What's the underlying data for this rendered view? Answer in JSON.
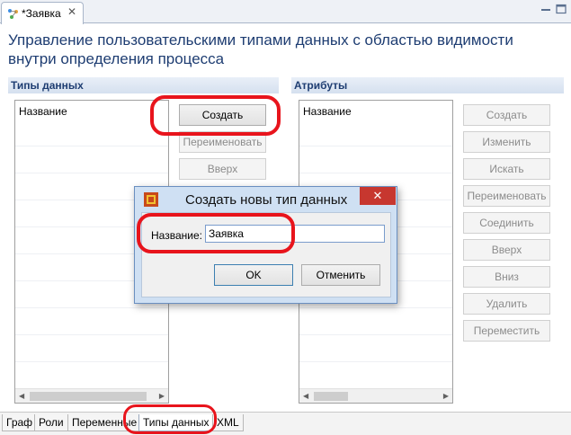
{
  "editor_tab": {
    "title": "*Заявка",
    "close_symbol": "✕"
  },
  "page_title": "Управление пользовательскими типами данных с областью видимости внутри определения процесса",
  "types_section": {
    "header": "Типы данных",
    "column_header": "Название",
    "buttons": {
      "create": "Создать",
      "rename": "Переименовать",
      "up": "Вверх"
    }
  },
  "attributes_section": {
    "header": "Атрибуты",
    "column_header": "Название",
    "buttons": {
      "create": "Создать",
      "edit": "Изменить",
      "search": "Искать",
      "rename": "Переименовать",
      "join": "Соединить",
      "up": "Вверх",
      "down": "Вниз",
      "delete": "Удалить",
      "move": "Переместить"
    }
  },
  "dialog": {
    "title": "Создать новы тип данных",
    "close_symbol": "✕",
    "name_label": "Название:",
    "name_value": "Заявка",
    "ok": "OK",
    "cancel": "Отменить"
  },
  "bottom_tabs": [
    "Граф",
    "Роли",
    "Переменные",
    "Типы данных",
    "XML"
  ],
  "colors": {
    "title": "#1e3d72",
    "annotation": "#e8141c",
    "dialog_close": "#c7372f"
  }
}
